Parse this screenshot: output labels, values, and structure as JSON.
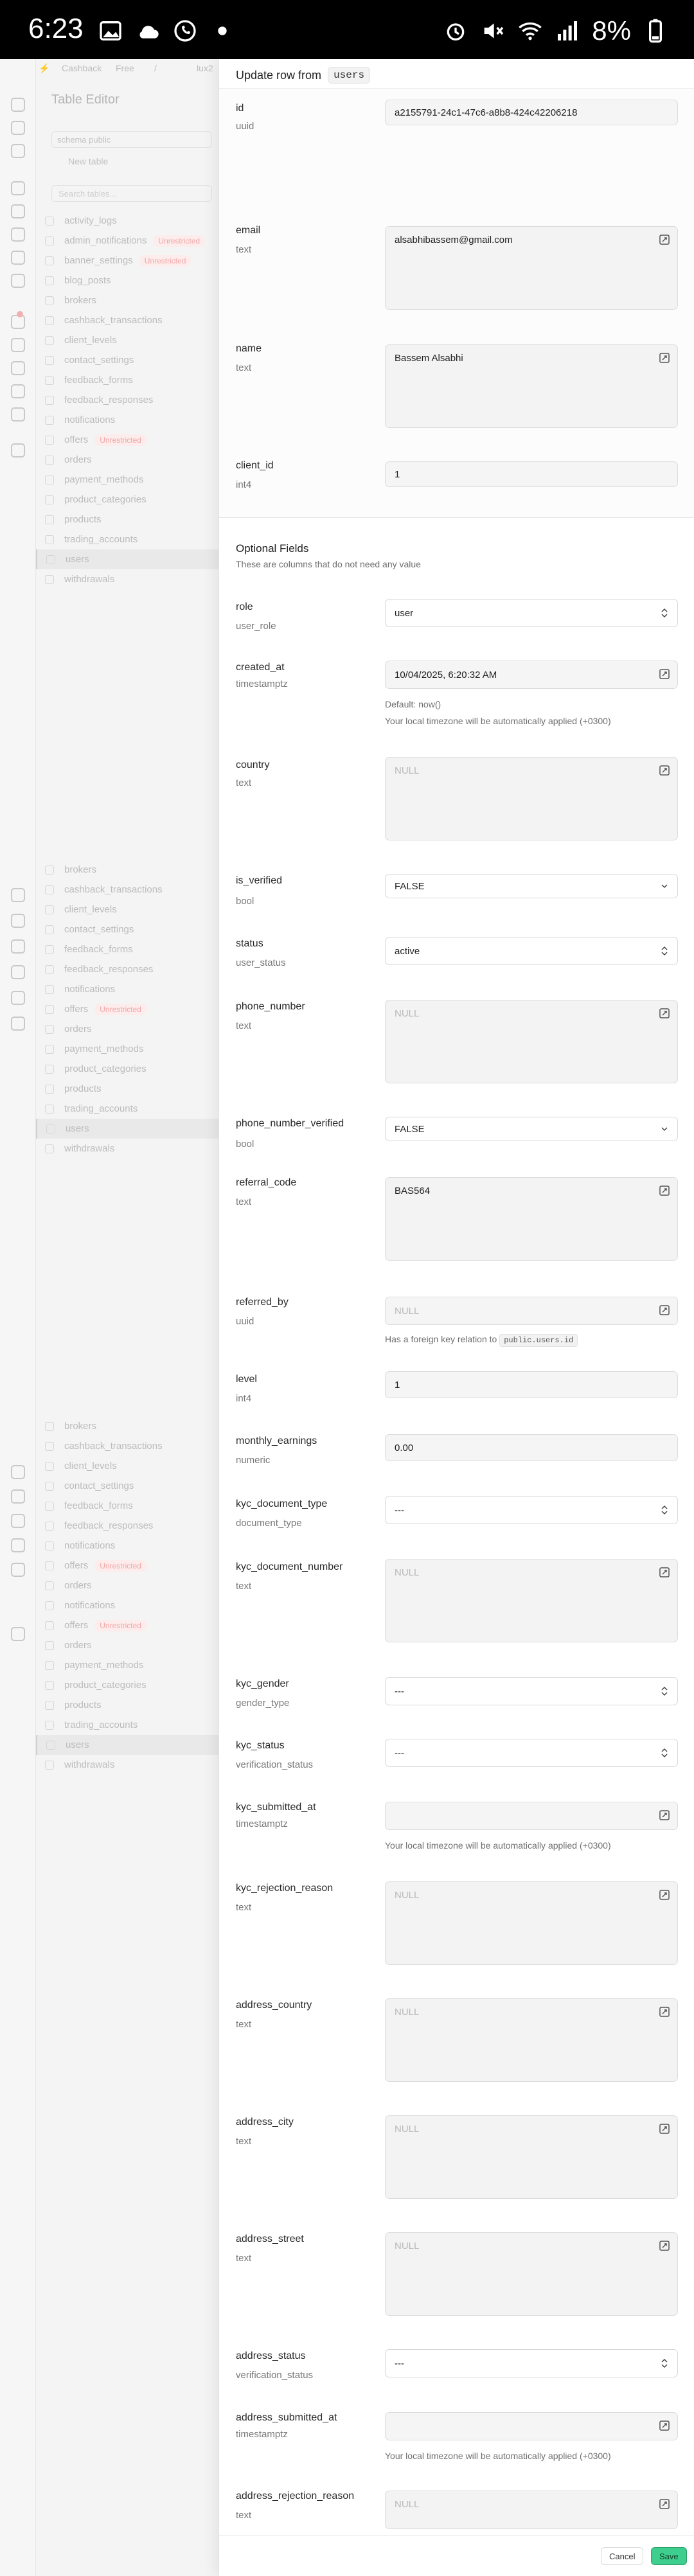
{
  "status_bar": {
    "time": "6:23",
    "battery": "8%"
  },
  "background": {
    "crumbs": [
      "Cashback",
      "Free",
      "/",
      "lux2"
    ],
    "title": "Table Editor",
    "schema": "schema public",
    "new_table": "New table",
    "search_placeholder": "Search tables...",
    "badge_unrestricted": "Unrestricted",
    "list1": [
      {
        "name": "activity_logs"
      },
      {
        "name": "admin_notifications",
        "badge": true
      },
      {
        "name": "banner_settings",
        "badge": true
      },
      {
        "name": "blog_posts"
      },
      {
        "name": "brokers"
      },
      {
        "name": "cashback_transactions"
      },
      {
        "name": "client_levels"
      },
      {
        "name": "contact_settings"
      },
      {
        "name": "feedback_forms"
      },
      {
        "name": "feedback_responses"
      },
      {
        "name": "notifications"
      },
      {
        "name": "offers",
        "badge": true
      },
      {
        "name": "orders"
      },
      {
        "name": "payment_methods"
      },
      {
        "name": "product_categories"
      },
      {
        "name": "products"
      },
      {
        "name": "trading_accounts"
      },
      {
        "name": "users",
        "selected": true
      },
      {
        "name": "withdrawals"
      }
    ],
    "list2": [
      {
        "name": "brokers"
      },
      {
        "name": "cashback_transactions"
      },
      {
        "name": "client_levels"
      },
      {
        "name": "contact_settings"
      },
      {
        "name": "feedback_forms"
      },
      {
        "name": "feedback_responses"
      },
      {
        "name": "notifications"
      },
      {
        "name": "offers",
        "badge": true
      },
      {
        "name": "orders"
      },
      {
        "name": "payment_methods"
      },
      {
        "name": "product_categories"
      },
      {
        "name": "products"
      },
      {
        "name": "trading_accounts"
      },
      {
        "name": "users",
        "selected": true
      },
      {
        "name": "withdrawals"
      }
    ],
    "list3": [
      {
        "name": "brokers"
      },
      {
        "name": "cashback_transactions"
      },
      {
        "name": "client_levels"
      },
      {
        "name": "contact_settings"
      },
      {
        "name": "feedback_forms"
      },
      {
        "name": "feedback_responses"
      },
      {
        "name": "notifications"
      },
      {
        "name": "offers",
        "badge": true
      },
      {
        "name": "orders"
      },
      {
        "name": "notifications"
      },
      {
        "name": "offers",
        "badge": true
      },
      {
        "name": "orders"
      },
      {
        "name": "payment_methods"
      },
      {
        "name": "product_categories"
      },
      {
        "name": "products"
      },
      {
        "name": "trading_accounts"
      },
      {
        "name": "users",
        "selected": true
      },
      {
        "name": "withdrawals"
      }
    ]
  },
  "panel": {
    "title": "Update row from",
    "table": "users",
    "required": {
      "id": {
        "name": "id",
        "type": "uuid",
        "value": "a2155791-24c1-47c6-a8b8-424c42206218"
      },
      "email": {
        "name": "email",
        "type": "text",
        "value": "alsabhibassem@gmail.com"
      },
      "fullname": {
        "name": "name",
        "type": "text",
        "value": "Bassem Alsabhi"
      },
      "client_id": {
        "name": "client_id",
        "type": "int4",
        "value": "1"
      }
    },
    "optional_title": "Optional Fields",
    "optional_subtitle": "These are columns that do not need any value",
    "null_text": "NULL",
    "tz_hint": "Your local timezone will be automatically applied (+0300)",
    "fk_hint": "Has a foreign key relation to",
    "fk_target": "public.users.id",
    "fields": {
      "role": {
        "name": "role",
        "type": "user_role",
        "value": "user"
      },
      "created_at": {
        "name": "created_at",
        "type": "timestamptz",
        "value": "10/04/2025, 6:20:32 AM",
        "default": "Default: now()"
      },
      "country": {
        "name": "country",
        "type": "text"
      },
      "is_verified": {
        "name": "is_verified",
        "type": "bool",
        "value": "FALSE"
      },
      "status": {
        "name": "status",
        "type": "user_status",
        "value": "active"
      },
      "phone_number": {
        "name": "phone_number",
        "type": "text"
      },
      "phone_number_verified": {
        "name": "phone_number_verified",
        "type": "bool",
        "value": "FALSE"
      },
      "referral_code": {
        "name": "referral_code",
        "type": "text",
        "value": "BAS564"
      },
      "referred_by": {
        "name": "referred_by",
        "type": "uuid"
      },
      "level": {
        "name": "level",
        "type": "int4",
        "value": "1"
      },
      "monthly_earnings": {
        "name": "monthly_earnings",
        "type": "numeric",
        "value": "0.00"
      },
      "kyc_document_type": {
        "name": "kyc_document_type",
        "type": "document_type",
        "value": "---"
      },
      "kyc_document_number": {
        "name": "kyc_document_number",
        "type": "text"
      },
      "kyc_gender": {
        "name": "kyc_gender",
        "type": "gender_type",
        "value": "---"
      },
      "kyc_status": {
        "name": "kyc_status",
        "type": "verification_status",
        "value": "---"
      },
      "kyc_submitted_at": {
        "name": "kyc_submitted_at",
        "type": "timestamptz"
      },
      "kyc_rejection_reason": {
        "name": "kyc_rejection_reason",
        "type": "text"
      },
      "address_country": {
        "name": "address_country",
        "type": "text"
      },
      "address_city": {
        "name": "address_city",
        "type": "text"
      },
      "address_street": {
        "name": "address_street",
        "type": "text"
      },
      "address_status": {
        "name": "address_status",
        "type": "verification_status",
        "value": "---"
      },
      "address_submitted_at": {
        "name": "address_submitted_at",
        "type": "timestamptz"
      },
      "address_rejection_reason": {
        "name": "address_rejection_reason",
        "type": "text"
      }
    },
    "cancel_label": "Cancel",
    "save_label": "Save"
  }
}
